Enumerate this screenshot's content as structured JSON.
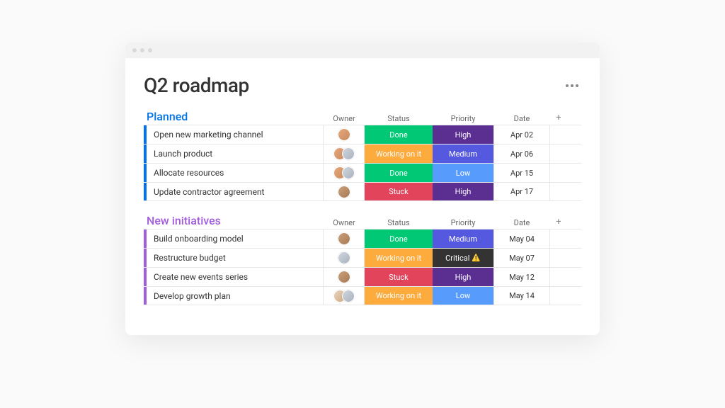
{
  "page": {
    "title": "Q2 roadmap"
  },
  "columns": {
    "owner": "Owner",
    "status": "Status",
    "priority": "Priority",
    "date": "Date"
  },
  "colors": {
    "done": "#00c875",
    "working": "#fdab3d",
    "stuck": "#e2445c",
    "high": "#5b2e91",
    "medium": "#5559df",
    "low": "#579bfc",
    "critical": "#333333"
  },
  "groups": [
    {
      "title": "Planned",
      "accent": "blue",
      "rows": [
        {
          "name": "Open new marketing channel",
          "owners": [
            "v1"
          ],
          "status": "Done",
          "status_key": "done",
          "priority": "High",
          "priority_key": "high",
          "date": "Apr 02"
        },
        {
          "name": "Launch product",
          "owners": [
            "v1",
            "v2"
          ],
          "status": "Working on it",
          "status_key": "working",
          "priority": "Medium",
          "priority_key": "medium",
          "date": "Apr 06"
        },
        {
          "name": "Allocate resources",
          "owners": [
            "v1",
            "v2"
          ],
          "status": "Done",
          "status_key": "done",
          "priority": "Low",
          "priority_key": "low",
          "date": "Apr 15"
        },
        {
          "name": "Update contractor agreement",
          "owners": [
            "v3"
          ],
          "status": "Stuck",
          "status_key": "stuck",
          "priority": "High",
          "priority_key": "high",
          "date": "Apr 17"
        }
      ]
    },
    {
      "title": "New initiatives",
      "accent": "purple",
      "rows": [
        {
          "name": "Build onboarding model",
          "owners": [
            "v3"
          ],
          "status": "Done",
          "status_key": "done",
          "priority": "Medium",
          "priority_key": "medium",
          "date": "May 04"
        },
        {
          "name": "Restructure budget",
          "owners": [
            "v2"
          ],
          "status": "Working on it",
          "status_key": "working",
          "priority": "Critical",
          "priority_key": "critical",
          "warn": true,
          "date": "May 07"
        },
        {
          "name": "Create new events series",
          "owners": [
            "v3"
          ],
          "status": "Stuck",
          "status_key": "stuck",
          "priority": "High",
          "priority_key": "high",
          "date": "May 12"
        },
        {
          "name": "Develop growth plan",
          "owners": [
            "v4",
            "v2"
          ],
          "status": "Working on it",
          "status_key": "working",
          "priority": "Low",
          "priority_key": "low",
          "date": "May 14"
        }
      ]
    }
  ]
}
